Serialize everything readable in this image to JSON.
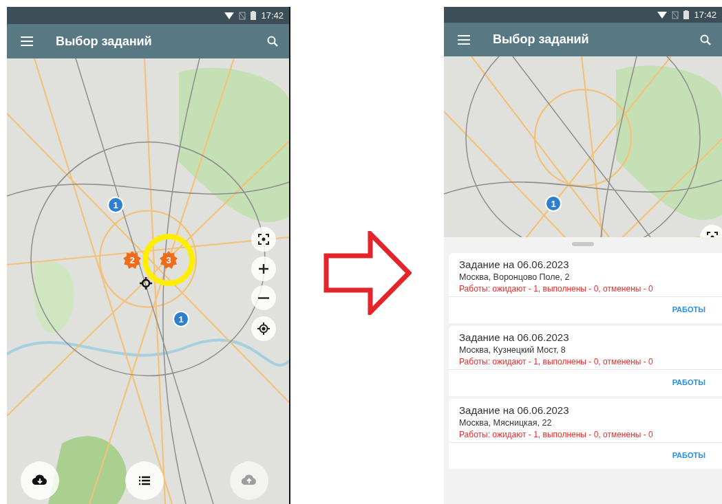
{
  "phones": [
    {
      "status_bar": {
        "time": "17:42"
      },
      "app_bar": {
        "title": "Выбор заданий"
      },
      "map": {
        "markers": [
          {
            "kind": "single",
            "label": "1",
            "highlighted": false
          },
          {
            "kind": "cluster",
            "label": "2",
            "highlighted": false
          },
          {
            "kind": "cluster",
            "label": "3",
            "highlighted": true
          },
          {
            "kind": "single",
            "label": "1",
            "highlighted": false
          },
          {
            "kind": "location"
          }
        ],
        "controls": [
          {
            "kind": "focus"
          },
          {
            "kind": "zoom-in"
          },
          {
            "kind": "zoom-out"
          },
          {
            "kind": "locate"
          }
        ],
        "fabs": [
          {
            "kind": "download",
            "disabled": false
          },
          {
            "kind": "list",
            "disabled": false
          },
          {
            "kind": "upload",
            "disabled": true
          }
        ]
      }
    },
    {
      "status_bar": {
        "time": "17:42"
      },
      "app_bar": {
        "title": "Выбор заданий"
      },
      "map": {
        "markers": [
          {
            "kind": "single",
            "label": "1",
            "highlighted": false
          }
        ],
        "controls": [
          {
            "kind": "focus"
          }
        ]
      },
      "sheet": {
        "tasks": [
          {
            "title": "Задание на 06.06.2023",
            "address": "Москва, Воронцово Поле,  2",
            "status": "Работы: ожидают - 1, выполнены - 0, отменены - 0",
            "button": "РАБОТЫ"
          },
          {
            "title": "Задание на 06.06.2023",
            "address": "Москва, Кузнецкий Мост,  8",
            "status": "Работы: ожидают - 1, выполнены - 0, отменены - 0",
            "button": "РАБОТЫ"
          },
          {
            "title": "Задание на 06.06.2023",
            "address": "Москва, Мясницкая,  22",
            "status": "Работы: ожидают - 1, выполнены - 0, отменены - 0",
            "button": "РАБОТЫ"
          }
        ]
      }
    }
  ]
}
